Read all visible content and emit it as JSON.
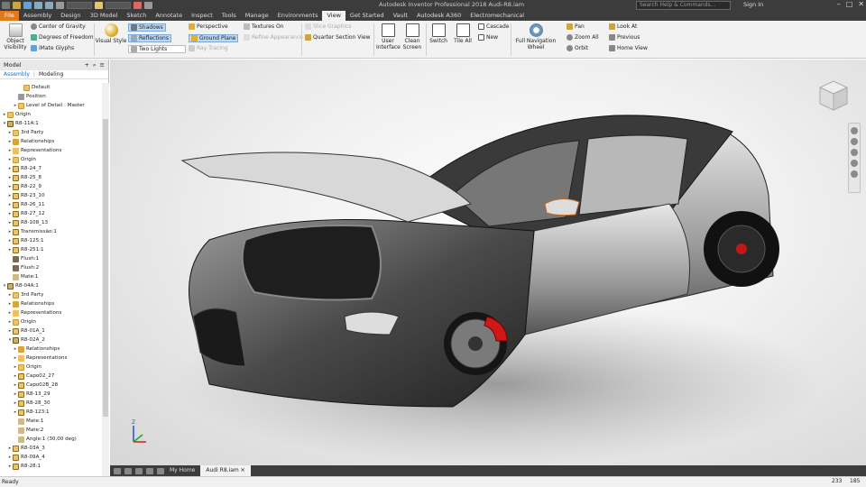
{
  "app": {
    "title": "Autodesk Inventor Professional 2018    Audi-R8.iam",
    "search_placeholder": "Search Help & Commands...",
    "sign_in": "Sign In"
  },
  "ribbon_tabs": [
    "File",
    "Assembly",
    "Design",
    "3D Model",
    "Sketch",
    "Annotate",
    "Inspect",
    "Tools",
    "Manage",
    "Environments",
    "View",
    "Get Started",
    "Vault",
    "Autodesk A360",
    "Electromechanical"
  ],
  "active_tab": "View",
  "ribbon": {
    "object_visibility": "Object Visibility",
    "center_of_gravity": "Center of Gravity",
    "degrees_of_freedom": "Degrees of Freedom",
    "imate_glyphs": "iMate Glyphs",
    "visual_style": "Visual Style",
    "shadows": "Shadows",
    "reflections": "Reflections",
    "two_lights": "Two Lights",
    "perspective": "Perspective",
    "ground_plane": "Ground Plane",
    "ray_tracing": "Ray Tracing",
    "textures_on": "Textures On",
    "refine_appearance": "Refine Appearance",
    "slice_graphics": "Slice Graphics",
    "quarter_section_view": "Quarter Section View",
    "user_interface": "User Interface",
    "clean_screen": "Clean Screen",
    "switch": "Switch",
    "tile_all": "Tile All",
    "cascade": "Cascade",
    "new": "New",
    "full_navigation_wheel": "Full Navigation Wheel",
    "pan": "Pan",
    "zoom_all": "Zoom All",
    "orbit": "Orbit",
    "look_at": "Look At",
    "previous": "Previous",
    "home_view": "Home View"
  },
  "panel": {
    "title": "Model",
    "tab_assembly": "Assembly",
    "tab_modeling": "Modeling",
    "tree": [
      {
        "label": "Default",
        "indent": 3,
        "icon": "folder",
        "exp": ""
      },
      {
        "label": "Position",
        "indent": 2,
        "icon": "pos",
        "exp": ""
      },
      {
        "label": "Level of Detail : Master",
        "indent": 2,
        "icon": "folder",
        "exp": "▸"
      },
      {
        "label": "Origin",
        "indent": 0,
        "icon": "folder",
        "exp": "▸"
      },
      {
        "label": "R8-11A:1",
        "indent": 0,
        "icon": "asm",
        "exp": "▾"
      },
      {
        "label": "3rd Party",
        "indent": 1,
        "icon": "folder",
        "exp": "▸"
      },
      {
        "label": "Relationships",
        "indent": 1,
        "icon": "rel",
        "exp": "▸"
      },
      {
        "label": "Representations",
        "indent": 1,
        "icon": "rep",
        "exp": "▸"
      },
      {
        "label": "Origin",
        "indent": 1,
        "icon": "folder",
        "exp": "▸"
      },
      {
        "label": "R8-24_7",
        "indent": 1,
        "icon": "part",
        "exp": "▸"
      },
      {
        "label": "R8-25_8",
        "indent": 1,
        "icon": "part",
        "exp": "▸"
      },
      {
        "label": "R8-22_9",
        "indent": 1,
        "icon": "part",
        "exp": "▸"
      },
      {
        "label": "R8-23_10",
        "indent": 1,
        "icon": "part",
        "exp": "▸"
      },
      {
        "label": "R8-26_11",
        "indent": 1,
        "icon": "part",
        "exp": "▸"
      },
      {
        "label": "R8-27_12",
        "indent": 1,
        "icon": "part",
        "exp": "▸"
      },
      {
        "label": "R8-108_13",
        "indent": 1,
        "icon": "part",
        "exp": "▸"
      },
      {
        "label": "Transmissão:1",
        "indent": 1,
        "icon": "part",
        "exp": "▸"
      },
      {
        "label": "R8-125:1",
        "indent": 1,
        "icon": "part",
        "exp": "▸"
      },
      {
        "label": "R8-251:1",
        "indent": 1,
        "icon": "part",
        "exp": "▸"
      },
      {
        "label": "Flush:1",
        "indent": 1,
        "icon": "flush",
        "exp": ""
      },
      {
        "label": "Flush:2",
        "indent": 1,
        "icon": "flush",
        "exp": ""
      },
      {
        "label": "Mate:1",
        "indent": 1,
        "icon": "mate",
        "exp": ""
      },
      {
        "label": "R8-04A:1",
        "indent": 0,
        "icon": "asm",
        "exp": "▾"
      },
      {
        "label": "3rd Party",
        "indent": 1,
        "icon": "folder",
        "exp": "▸"
      },
      {
        "label": "Relationships",
        "indent": 1,
        "icon": "rel",
        "exp": "▸"
      },
      {
        "label": "Representations",
        "indent": 1,
        "icon": "rep",
        "exp": "▸"
      },
      {
        "label": "Origin",
        "indent": 1,
        "icon": "folder",
        "exp": "▸"
      },
      {
        "label": "R8-01A_1",
        "indent": 1,
        "icon": "part",
        "exp": "▸"
      },
      {
        "label": "R8-02A_2",
        "indent": 1,
        "icon": "asm",
        "exp": "▾"
      },
      {
        "label": "Relationships",
        "indent": 2,
        "icon": "rel",
        "exp": "▸"
      },
      {
        "label": "Representations",
        "indent": 2,
        "icon": "rep",
        "exp": "▸"
      },
      {
        "label": "Origin",
        "indent": 2,
        "icon": "folder",
        "exp": "▸"
      },
      {
        "label": "Capo02_27",
        "indent": 2,
        "icon": "part",
        "exp": "▸"
      },
      {
        "label": "Capo02B_28",
        "indent": 2,
        "icon": "part",
        "exp": "▸"
      },
      {
        "label": "R8-13_29",
        "indent": 2,
        "icon": "part",
        "exp": "▸"
      },
      {
        "label": "R8-28_30",
        "indent": 2,
        "icon": "part",
        "exp": "▸"
      },
      {
        "label": "R8-123:1",
        "indent": 2,
        "icon": "part",
        "exp": "▸"
      },
      {
        "label": "Mate:1",
        "indent": 2,
        "icon": "mate",
        "exp": ""
      },
      {
        "label": "Mate:2",
        "indent": 2,
        "icon": "mate",
        "exp": ""
      },
      {
        "label": "Angle:1 (30,00 deg)",
        "indent": 2,
        "icon": "mate",
        "exp": ""
      },
      {
        "label": "R8-03A_3",
        "indent": 1,
        "icon": "part",
        "exp": "▸"
      },
      {
        "label": "R8-09A_4",
        "indent": 1,
        "icon": "part",
        "exp": "▸"
      },
      {
        "label": "R8-28:1",
        "indent": 1,
        "icon": "part",
        "exp": "▸"
      }
    ]
  },
  "doc_tabs": {
    "home": "My Home",
    "active": "Audi R8.iam"
  },
  "status": {
    "left": "Ready",
    "num1": "233",
    "num2": "185"
  },
  "colors": {
    "file_tab": "#e07a1a",
    "caliper": "#d01818",
    "title_bg": "#3c3c3c"
  }
}
